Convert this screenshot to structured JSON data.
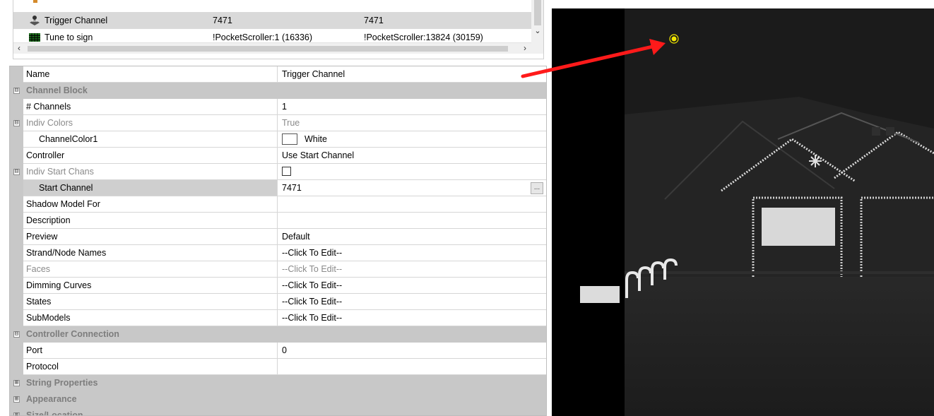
{
  "model_list": {
    "rows": [
      {
        "name": "Trigger Channel",
        "start": "7471",
        "end": "7471",
        "icon": "model-tree-icon"
      },
      {
        "name": "Tune to sign",
        "start": "!PocketScroller:1 (16336)",
        "end": "!PocketScroller:13824 (30159)",
        "icon": "matrix-grid-icon"
      }
    ],
    "scroll_left_icon": "‹",
    "scroll_right_icon": "›",
    "scroll_down_icon": "⌄"
  },
  "properties": {
    "name_label": "Name",
    "name_value": "Trigger Channel",
    "channel_block": {
      "label": "Channel Block",
      "toggle": "⊟",
      "num_channels_label": "# Channels",
      "num_channels_value": "1",
      "indiv_colors_label": "Indiv Colors",
      "indiv_colors_value": "True",
      "channel_color_label": "ChannelColor1",
      "channel_color_value": "White",
      "channel_color_hex": "#ffffff"
    },
    "controller_label": "Controller",
    "controller_value": "Use Start Channel",
    "indiv_start_chans_label": "Indiv Start Chans",
    "start_channel_label": "Start Channel",
    "start_channel_value": "7471",
    "ellipsis_label": "...",
    "shadow_model_label": "Shadow Model For",
    "description_label": "Description",
    "preview_label": "Preview",
    "preview_value": "Default",
    "strand_names_label": "Strand/Node Names",
    "strand_names_value": "--Click To Edit--",
    "faces_label": "Faces",
    "faces_value": "--Click To Edit--",
    "dimming_curves_label": "Dimming Curves",
    "dimming_curves_value": "--Click To Edit--",
    "states_label": "States",
    "states_value": "--Click To Edit--",
    "submodels_label": "SubModels",
    "submodels_value": "--Click To Edit--",
    "controller_connection": {
      "label": "Controller Connection",
      "port_label": "Port",
      "port_value": "0",
      "protocol_label": "Protocol"
    },
    "string_properties_label": "String Properties",
    "appearance_label": "Appearance",
    "size_location_label": "Size/Location",
    "collapsed_toggle": "⊞",
    "expanded_toggle": "⊟"
  },
  "preview": {
    "background": "#1d1d1d",
    "highlight_color": "#f2e600"
  },
  "annotation": {
    "arrow_color": "#ff1a1a"
  }
}
